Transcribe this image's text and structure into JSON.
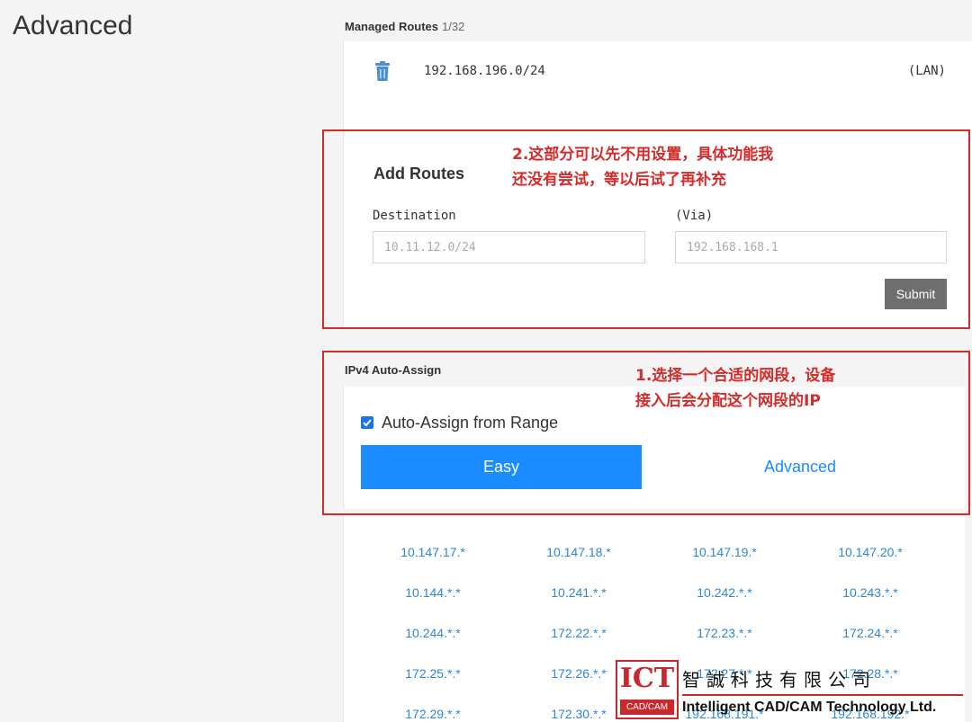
{
  "page": {
    "title": "Advanced"
  },
  "managed_routes": {
    "label": "Managed Routes",
    "count": "1/32",
    "routes": [
      {
        "ip": "192.168.196.0/24",
        "tag": "(LAN)",
        "icon": "trash-icon"
      }
    ]
  },
  "add_routes": {
    "heading": "Add Routes",
    "destination_label": "Destination",
    "destination_placeholder": "10.11.12.0/24",
    "via_label": "(Via)",
    "via_placeholder": "192.168.168.1",
    "submit_label": "Submit"
  },
  "ipv4": {
    "label": "IPv4 Auto-Assign",
    "checkbox_label": "Auto-Assign from Range",
    "checkbox_checked": true,
    "tabs": [
      {
        "label": "Easy",
        "active": true
      },
      {
        "label": "Advanced",
        "active": false
      }
    ],
    "ranges": [
      "10.147.17.*",
      "10.147.18.*",
      "10.147.19.*",
      "10.147.20.*",
      "10.144.*.*",
      "10.241.*.*",
      "10.242.*.*",
      "10.243.*.*",
      "10.244.*.*",
      "172.22.*.*",
      "172.23.*.*",
      "172.24.*.*",
      "172.25.*.*",
      "172.26.*.*",
      "172.27.*.*",
      "172.28.*.*",
      "172.29.*.*",
      "172.30.*.*",
      "192.168.191.*",
      "192.168.192.*"
    ]
  },
  "annotations": {
    "note2_line1": "2.这部分可以先不用设置，具体功能我",
    "note2_line2": "还没有尝试，等以后试了再补充",
    "note1_line1": "1.选择一个合适的网段，设备",
    "note1_line2": "接入后会分配这个网段的IP"
  },
  "watermark": {
    "logo_text": "ICT",
    "logo_sub": "CAD/CAM",
    "company_cn": "智誠科技有限公司",
    "company_en": "Intelligent CAD/CAM Technology Ltd."
  },
  "colors": {
    "accent": "#1a8cff",
    "link": "#2b87d8",
    "annotation_red": "#d42b2b",
    "submit_bg": "#6e6e6e"
  }
}
